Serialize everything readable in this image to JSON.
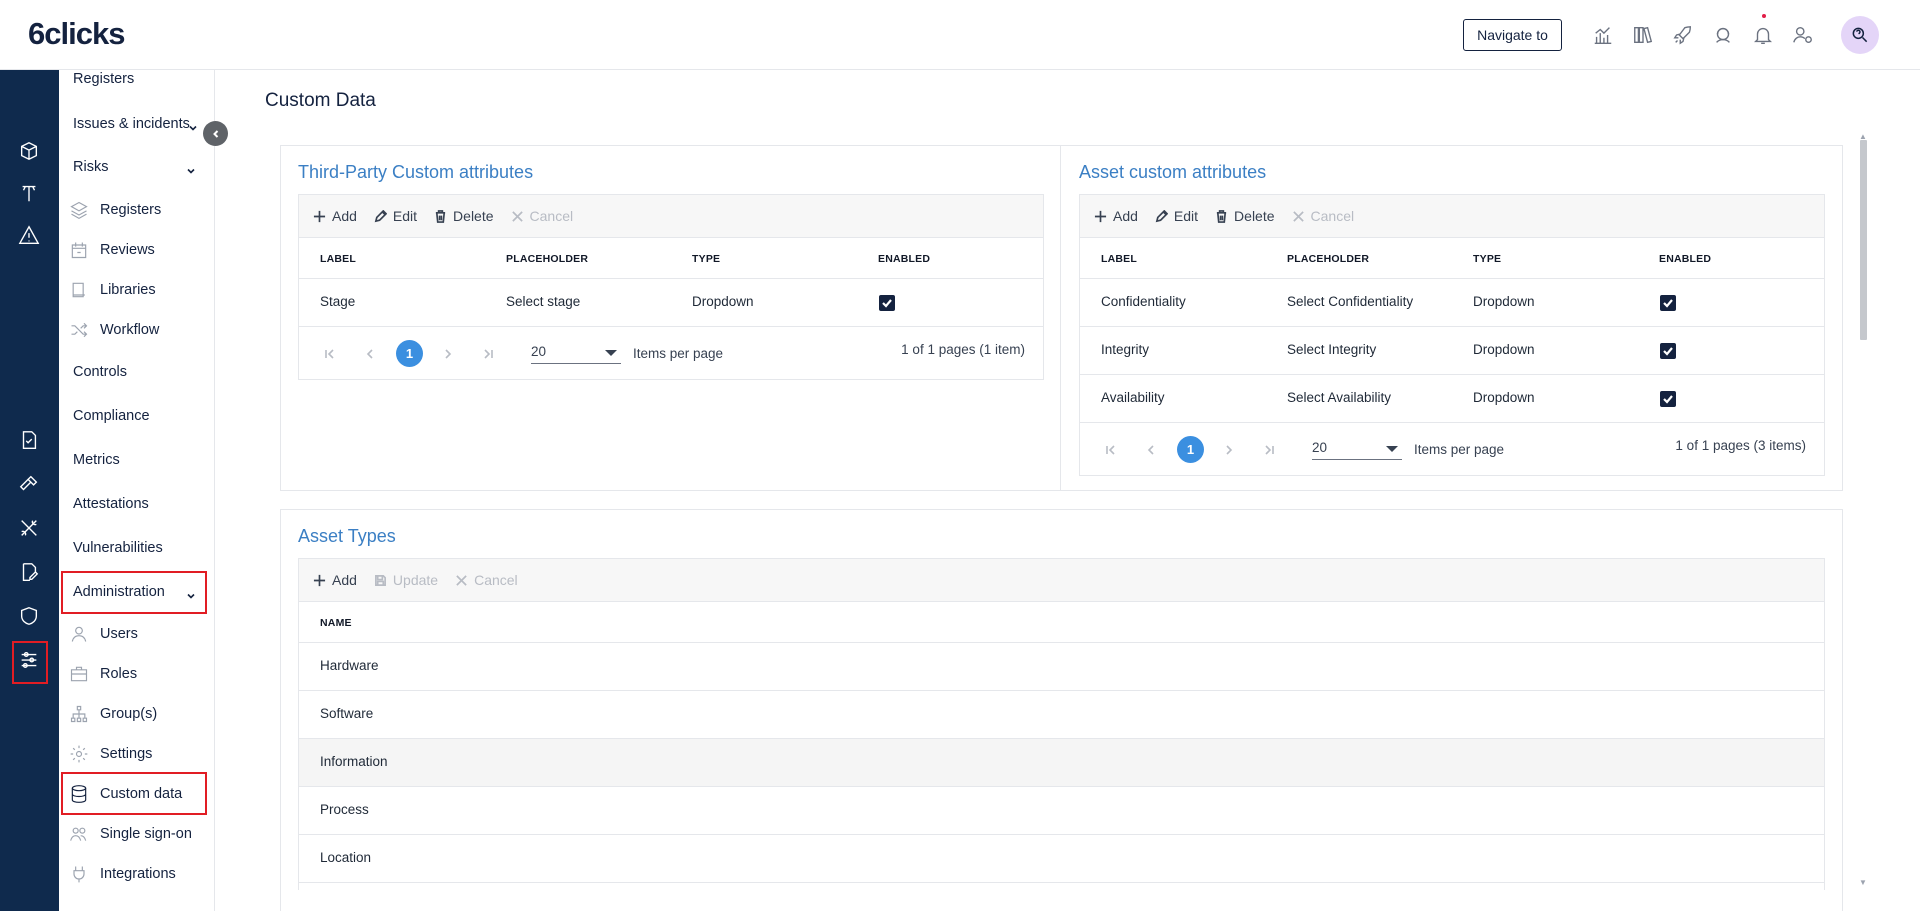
{
  "app": {
    "logo": "6clicks"
  },
  "topbar": {
    "navigate_label": "Navigate to",
    "icons": [
      "dashboard-chart-icon",
      "library-icon",
      "rocket-icon",
      "support-agent-icon",
      "bell-icon",
      "user-settings-icon"
    ],
    "avatar_icon": "search-help-icon"
  },
  "rail": {
    "icons": [
      "registers-box-icon",
      "tower-icon",
      "warning-icon",
      "checklist-icon",
      "tools-icon",
      "wrench-cross-icon",
      "signature-icon",
      "shield-icon",
      "sliders-icon"
    ]
  },
  "sidebar": {
    "registers_top": "Registers",
    "issues": "Issues & incidents",
    "risks": "Risks",
    "risks_children": {
      "registers": "Registers",
      "reviews": "Reviews",
      "libraries": "Libraries",
      "workflow": "Workflow"
    },
    "controls": "Controls",
    "compliance": "Compliance",
    "metrics": "Metrics",
    "attestations": "Attestations",
    "vulnerabilities": "Vulnerabilities",
    "administration": "Administration",
    "admin_children": {
      "users": "Users",
      "roles": "Roles",
      "groups": "Group(s)",
      "settings": "Settings",
      "custom_data": "Custom data",
      "sso": "Single sign-on",
      "integrations": "Integrations"
    }
  },
  "page": {
    "title": "Custom Data"
  },
  "third_party": {
    "title": "Third-Party Custom attributes",
    "toolbar": {
      "add": "Add",
      "edit": "Edit",
      "delete": "Delete",
      "cancel": "Cancel"
    },
    "headers": {
      "label": "LABEL",
      "placeholder": "PLACEHOLDER",
      "type": "TYPE",
      "enabled": "ENABLED"
    },
    "rows": [
      {
        "label": "Stage",
        "placeholder": "Select stage",
        "type": "Dropdown",
        "enabled": true
      }
    ],
    "pager": {
      "page": "1",
      "page_size": "20",
      "items_per_page": "Items per page",
      "info": "1 of 1 pages (1 item)"
    }
  },
  "asset_attrs": {
    "title": "Asset custom attributes",
    "toolbar": {
      "add": "Add",
      "edit": "Edit",
      "delete": "Delete",
      "cancel": "Cancel"
    },
    "headers": {
      "label": "LABEL",
      "placeholder": "PLACEHOLDER",
      "type": "TYPE",
      "enabled": "ENABLED"
    },
    "rows": [
      {
        "label": "Confidentiality",
        "placeholder": "Select Confidentiality",
        "type": "Dropdown",
        "enabled": true
      },
      {
        "label": "Integrity",
        "placeholder": "Select Integrity",
        "type": "Dropdown",
        "enabled": true
      },
      {
        "label": "Availability",
        "placeholder": "Select Availability",
        "type": "Dropdown",
        "enabled": true
      }
    ],
    "pager": {
      "page": "1",
      "page_size": "20",
      "items_per_page": "Items per page",
      "info": "1 of 1 pages (3 items)"
    }
  },
  "asset_types": {
    "title": "Asset Types",
    "toolbar": {
      "add": "Add",
      "update": "Update",
      "cancel": "Cancel"
    },
    "headers": {
      "name": "NAME"
    },
    "rows": [
      "Hardware",
      "Software",
      "Information",
      "Process",
      "Location"
    ]
  },
  "colors": {
    "rail_bg": "#0f2a4d",
    "accent": "#3b7fc4",
    "page_badge": "#3b8fe0",
    "highlight": "#e11d24"
  }
}
